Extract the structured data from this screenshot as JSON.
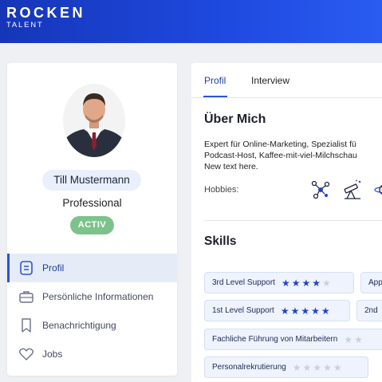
{
  "brand": {
    "name": "ROCKEN",
    "subtitle": "TALENT"
  },
  "profile": {
    "name": "Till Mustermann",
    "role": "Professional",
    "status": "ACTIV"
  },
  "nav": {
    "items": [
      {
        "label": "Profil",
        "icon": "document-icon",
        "active": true
      },
      {
        "label": "Persönliche Informationen",
        "icon": "briefcase-icon",
        "active": false
      },
      {
        "label": "Benachrichtigung",
        "icon": "bookmark-icon",
        "active": false
      },
      {
        "label": "Jobs",
        "icon": "heart-icon",
        "active": false
      }
    ]
  },
  "tabs": [
    {
      "label": "Profil",
      "active": true
    },
    {
      "label": "Interview",
      "active": false
    }
  ],
  "about": {
    "title": "Über Mich",
    "lines": [
      "Expert für Online-Marketing, Spezialist fü",
      "Podcast-Host, Kaffee-mit-viel-Milchschau",
      "New text here."
    ],
    "hobbies_label": "Hobbies:",
    "hobbies": [
      "molecule-icon",
      "telescope-icon",
      "planet-icon"
    ]
  },
  "skills": {
    "title": "Skills",
    "items": [
      {
        "label": "3rd Level Support",
        "rating": 4,
        "max": 5
      },
      {
        "label": "App",
        "rating": 0,
        "max": 0
      },
      {
        "label": "1st Level Support",
        "rating": 5,
        "max": 5
      },
      {
        "label": "2nd",
        "rating": 0,
        "max": 0
      },
      {
        "label": "Fachliche Führung von Mitarbeitern",
        "rating": 0,
        "max": 2
      },
      {
        "label": "Personalrekrutierung",
        "rating": 0,
        "max": 5
      }
    ]
  },
  "colors": {
    "header": "#1f4ae0",
    "accent": "#2e52d6",
    "status": "#7cc38b",
    "star_on": "#2244c8",
    "star_off": "#ccd0d8"
  }
}
